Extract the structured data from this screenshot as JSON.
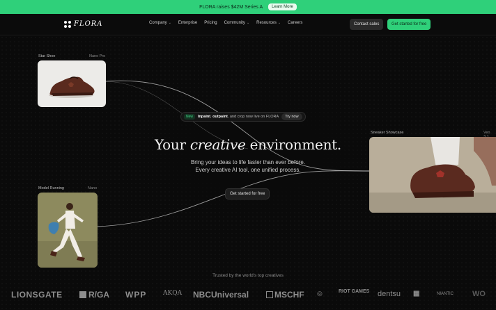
{
  "announcement": {
    "text": "FLORA raises $42M Series A",
    "button": "Learn More"
  },
  "nav": {
    "brand": "FLORA",
    "items": [
      {
        "label": "Company",
        "dropdown": true
      },
      {
        "label": "Enterprise",
        "dropdown": false
      },
      {
        "label": "Pricing",
        "dropdown": false
      },
      {
        "label": "Community",
        "dropdown": true
      },
      {
        "label": "Resources",
        "dropdown": true
      },
      {
        "label": "Careers",
        "dropdown": false
      }
    ],
    "contact": "Contact sales",
    "cta": "Get started for free"
  },
  "hero": {
    "badge": "New",
    "announce_bold1": "Inpaint",
    "announce_sep": ", ",
    "announce_bold2": "outpaint",
    "announce_rest": ", and crop now live on FLORA",
    "try": "Try now",
    "headline_pre": "Your ",
    "headline_italic": "creative",
    "headline_post": " environment.",
    "sub1": "Bring your ideas to life faster than ever before.",
    "sub2": "Every creative AI tool, one unified process.",
    "cta": "Get started for free"
  },
  "cards": [
    {
      "label": "Star Shoe",
      "model": "Nano Pro"
    },
    {
      "label": "Model Running",
      "model": "Nano"
    },
    {
      "label": "Sneaker Showcase",
      "model": "Veo 3.1"
    }
  ],
  "trusted": {
    "heading": "Trusted by the world's top creatives",
    "logos": [
      "LIONSGATE",
      "R/GA",
      "WPP",
      "AKQA",
      "NBCUniversal",
      "MSCHF",
      "RIOT GAMES",
      "dentsu",
      "NIANTIC",
      "WO"
    ]
  },
  "colors": {
    "accent": "#2fd07a",
    "background": "#0a0a0a"
  }
}
